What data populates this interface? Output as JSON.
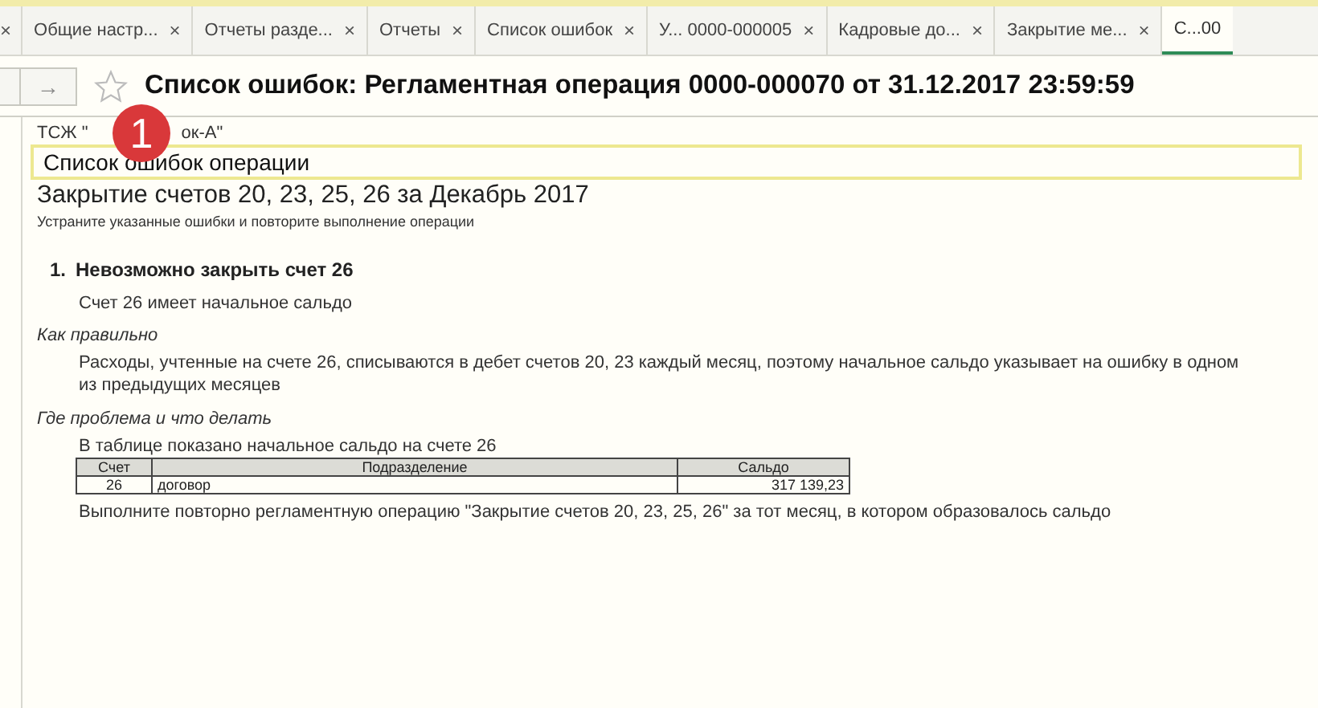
{
  "tabs": [
    {
      "close": "×",
      "selected": false
    },
    {
      "label": "Общие настр...",
      "close": "×",
      "selected": false
    },
    {
      "label": "Отчеты разде...",
      "close": "×",
      "selected": false
    },
    {
      "label": "Отчеты",
      "close": "×",
      "selected": false
    },
    {
      "label": "Список ошибок",
      "close": "×",
      "selected": false
    },
    {
      "label": "У... 0000-000005",
      "close": "×",
      "selected": false
    },
    {
      "label": "Кадровые до...",
      "close": "×",
      "selected": false
    },
    {
      "label": "Закрытие ме...",
      "close": "×",
      "selected": false
    },
    {
      "label": "С...00",
      "selected": true
    }
  ],
  "nav": {
    "forward": "→"
  },
  "window": {
    "title": "Список ошибок: Регламентная операция 0000-000070 от 31.12.2017 23:59:59",
    "favorite": false
  },
  "badge": "1",
  "report": {
    "org_left": "ТСЖ \"",
    "org_right": "ок-А\"",
    "heading": "Список ошибок операции",
    "subheading": "Закрытие счетов 20, 23, 25, 26 за Декабрь 2017",
    "hint": "Устраните указанные ошибки и повторите выполнение операции",
    "errors": [
      {
        "number": "1.",
        "title": "Невозможно закрыть счет 26",
        "description": "Счет 26 имеет начальное сальдо",
        "how_label": "Как правильно",
        "how_text": "Расходы, учтенные на счете 26, списываются в дебет счетов 20, 23 каждый месяц, поэтому начальное сальдо указывает на ошибку в одном из предыдущих месяцев",
        "fix_label": "Где проблема и что делать",
        "table_caption": "В таблице показано начальное сальдо на счете 26",
        "table": {
          "columns": [
            "Счет",
            "Подразделение",
            "Сальдо"
          ],
          "rows": [
            [
              "26",
              "договор",
              "317 139,23"
            ]
          ]
        },
        "action": "Выполните повторно регламентную операцию \"Закрытие счетов 20, 23, 25, 26\" за тот месяц, в котором образовалось сальдо"
      }
    ]
  }
}
